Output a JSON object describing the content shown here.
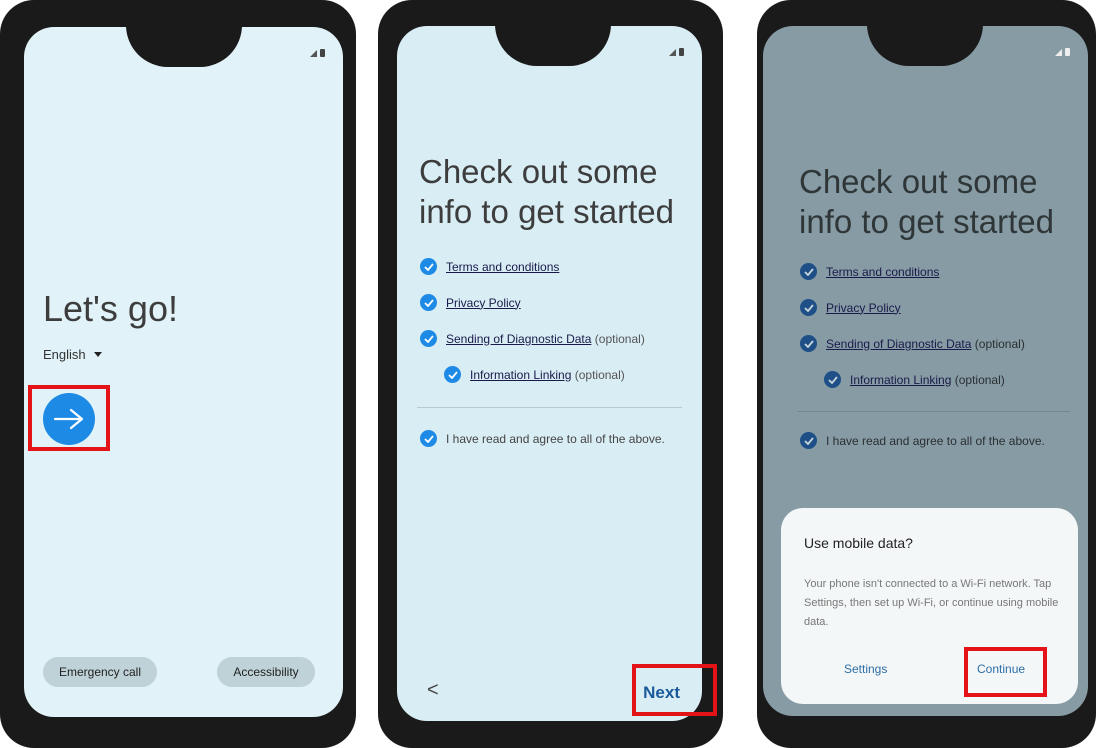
{
  "screen1": {
    "heading": "Let's go!",
    "language": "English",
    "buttons": {
      "emergency": "Emergency call",
      "accessibility": "Accessibility"
    }
  },
  "screen2": {
    "heading_line1": "Check out some",
    "heading_line2": "info to get started",
    "items": [
      {
        "link": "Terms and conditions",
        "suffix": ""
      },
      {
        "link": "Privacy Policy",
        "suffix": ""
      },
      {
        "link": "Sending of Diagnostic Data",
        "suffix": "(optional)"
      },
      {
        "link": "Information Linking",
        "suffix": "(optional)"
      }
    ],
    "agree": "I have read and agree to all of the above.",
    "back": "<",
    "next": "Next"
  },
  "screen3": {
    "heading_line1": "Check out some",
    "heading_line2": "info to get started",
    "items": [
      {
        "link": "Terms and conditions",
        "suffix": ""
      },
      {
        "link": "Privacy Policy",
        "suffix": ""
      },
      {
        "link": "Sending of Diagnostic Data",
        "suffix": "(optional)"
      },
      {
        "link": "Information Linking",
        "suffix": "(optional)"
      }
    ],
    "agree": "I have read and agree to all of the above.",
    "dialog": {
      "title": "Use mobile data?",
      "body": "Your phone isn't connected to a Wi-Fi network. Tap Settings, then set up Wi-Fi, or continue using mobile data.",
      "settings": "Settings",
      "continue": "Continue"
    }
  },
  "colors": {
    "accent": "#1d8be6",
    "highlight": "#e41318"
  }
}
